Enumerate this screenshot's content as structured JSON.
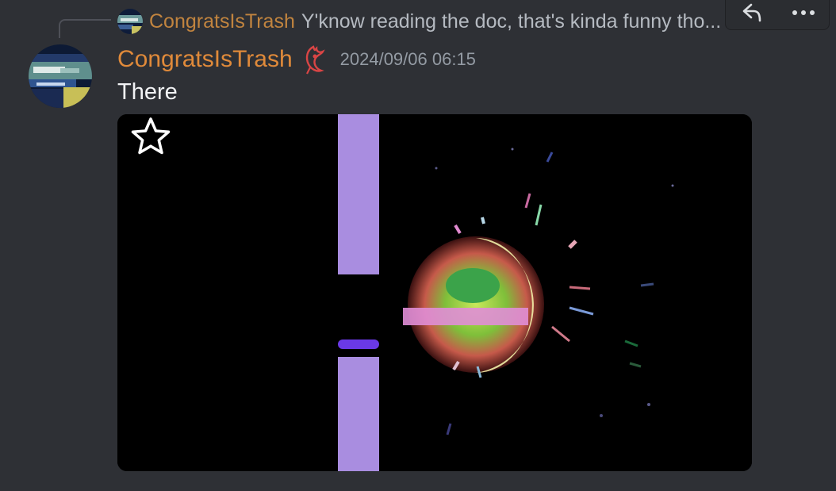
{
  "reply": {
    "author": "CongratsIsTrash",
    "text": "Y'know reading the doc, that's kinda funny tho..."
  },
  "message": {
    "author": "CongratsIsTrash",
    "timestamp": "2024/09/06 06:15",
    "text": "There"
  },
  "toolbar": {
    "reply_icon": "reply-icon",
    "more_icon": "more-icon"
  },
  "media": {
    "type": "gif",
    "favorite_icon": "star-icon"
  },
  "colors": {
    "background": "#2e3035",
    "author": "#e08a3a",
    "reply_author": "#c1843f",
    "timestamp": "#949ba4",
    "text": "#f2f3f5",
    "media_bg": "#000000"
  }
}
